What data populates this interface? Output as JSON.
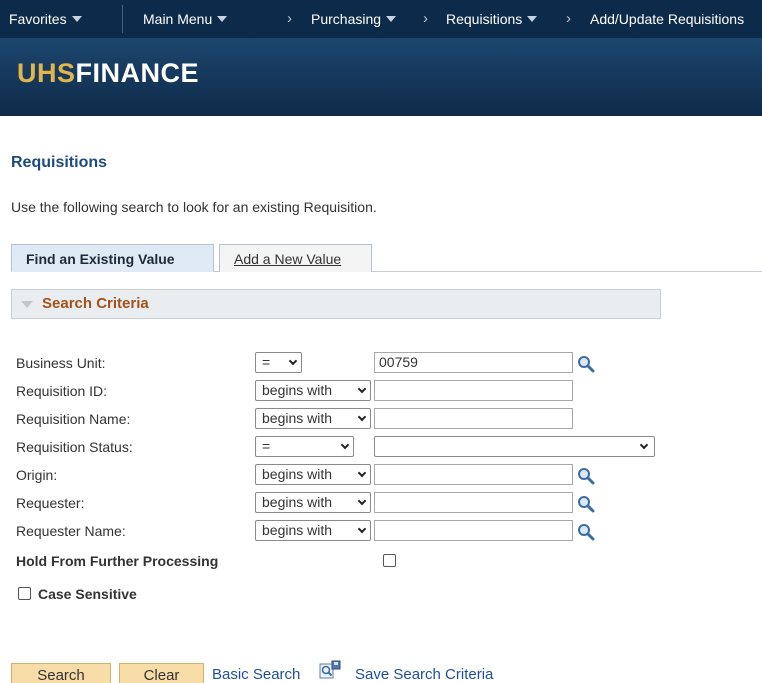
{
  "nav": {
    "favorites": "Favorites",
    "main_menu": "Main Menu",
    "breadcrumb": [
      "Purchasing",
      "Requisitions",
      "Add/Update Requisitions"
    ]
  },
  "brand": {
    "part1": "UHS",
    "part2": "FINANCE"
  },
  "page_title": "Requisitions",
  "instructions": "Use the following search to look for an existing Requisition.",
  "tabs": {
    "active": "Find an Existing Value",
    "inactive": "Add a New Value"
  },
  "section": {
    "title": "Search Criteria"
  },
  "fields": [
    {
      "label": "Business Unit:",
      "operator": "=",
      "value": "00759"
    },
    {
      "label": "Requisition ID:",
      "operator": "begins with",
      "value": ""
    },
    {
      "label": "Requisition Name:",
      "operator": "begins with",
      "value": ""
    },
    {
      "label": "Requisition Status:",
      "operator": "=",
      "value": ""
    },
    {
      "label": "Origin:",
      "operator": "begins with",
      "value": ""
    },
    {
      "label": "Requester:",
      "operator": "begins with",
      "value": ""
    },
    {
      "label": "Requester Name:",
      "operator": "begins with",
      "value": ""
    }
  ],
  "hold_label": "Hold From Further Processing",
  "case_sensitive_label": "Case Sensitive",
  "buttons": {
    "search": "Search",
    "clear": "Clear",
    "basic_search": "Basic Search",
    "save_search": "Save Search Criteria"
  },
  "colors": {
    "nav_bg": "#0c2a4a",
    "brand_accent": "#e0b64c",
    "title_blue": "#1d4b80",
    "section_orange": "#a1531c",
    "button_bg": "#f7dca8",
    "link_blue": "#1e4f9c"
  },
  "icons": [
    "dropdown-triangle-icon",
    "breadcrumb-chevron-icon",
    "collapse-triangle-icon",
    "lookup-magnifier-icon",
    "save-search-icon"
  ]
}
